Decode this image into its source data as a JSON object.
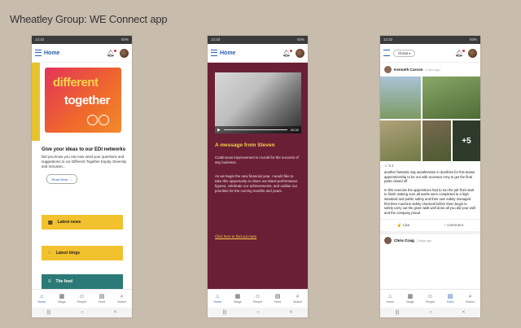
{
  "slide": {
    "title": "Wheatley Group: WE Connect app"
  },
  "status": {
    "time_1": "13:32",
    "time_2": "13:33",
    "time_3": "13:32",
    "battery": "93%"
  },
  "header": {
    "home_label": "Home",
    "global_label": "Global"
  },
  "nav": {
    "home": "Home",
    "blogs": "Blogs",
    "people": "People",
    "feed": "Feed",
    "search": "Search"
  },
  "phone1": {
    "hero_word1": "different",
    "hero_word2": "together",
    "heading": "Give your ideas to our EDI networks",
    "body": "Did you know you can now send your questions and suggestions to our Different Together Equity, Diversity and Inclusion...",
    "read_more": "Read More",
    "btn_news": "Latest news",
    "btn_blogs": "Latest blogs",
    "btn_feed": "The feed"
  },
  "phone2": {
    "video_time": "00:30",
    "heading": "A message from Steven",
    "para1": "Continuous improvement is crucial for the success of any business.",
    "para2": "As we begin the new financial year, I would like to take this opportunity to share our latest performance figures, celebrate our achievements, and outline our priorities for the coming months and years.",
    "link": "Click here to find out more"
  },
  "phone3": {
    "poster": "Kenneth Carson",
    "poster_time": "1 hour ago",
    "more_photos": "+5",
    "reactions": "5  2",
    "para1": "another fantastic day weatherwise in dumfries for this teams apprenticeship to be out with accessor Amy to get the final parts closed off",
    "para2": "In this exercise the apprentices had to run the job from start to finish making sure all works were completed to a high standard and public safety and their own safety managed first then machine safety checked before them begin to safely carry out the given task well done all you did your well and the company proud",
    "like": "Like",
    "comment": "Comment",
    "poster2": "Chris Craig",
    "poster2_time": "3 days ago"
  }
}
